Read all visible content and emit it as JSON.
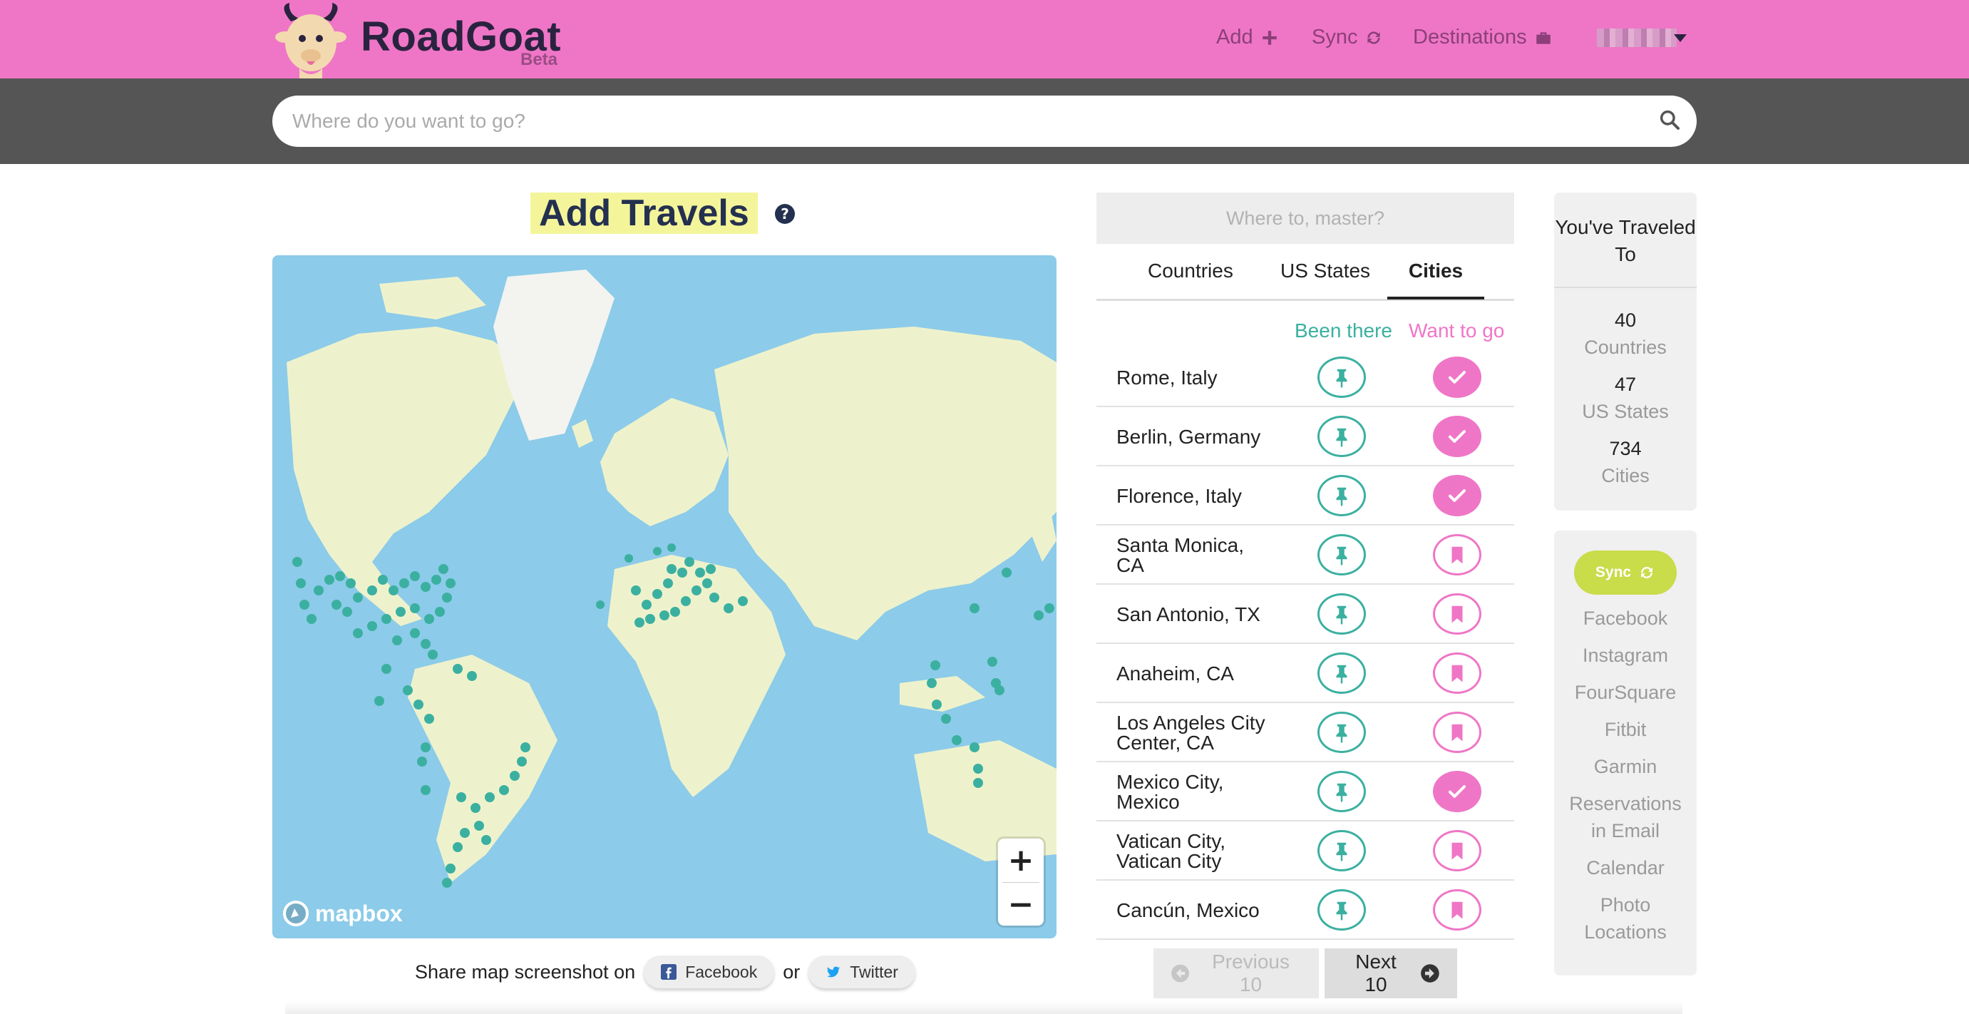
{
  "app": {
    "brand": "RoadGoat",
    "badge": "Beta"
  },
  "nav": [
    {
      "label": "Add",
      "icon": "plus-icon"
    },
    {
      "label": "Sync",
      "icon": "sync-icon"
    },
    {
      "label": "Destinations",
      "icon": "briefcase-icon"
    }
  ],
  "search": {
    "placeholder": "Where do you want to go?"
  },
  "page": {
    "title": "Add Travels"
  },
  "map": {
    "attribution": "mapbox",
    "zoom_in": "+",
    "zoom_out": "−"
  },
  "share": {
    "prefix": "Share map screenshot on",
    "or": "or",
    "facebook": "Facebook",
    "twitter": "Twitter"
  },
  "panel": {
    "search_placeholder": "Where to, master?",
    "tabs": [
      {
        "label": "Countries"
      },
      {
        "label": "US States"
      },
      {
        "label": "Cities",
        "active": true
      }
    ],
    "col_been": "Been there",
    "col_want": "Want to go",
    "rows": [
      {
        "name": "Rome, Italy",
        "want": true
      },
      {
        "name": "Berlin, Germany",
        "want": true
      },
      {
        "name": "Florence, Italy",
        "want": true
      },
      {
        "name": "Santa Monica, CA",
        "want": false
      },
      {
        "name": "San Antonio, TX",
        "want": false
      },
      {
        "name": "Anaheim, CA",
        "want": false
      },
      {
        "name": "Los Angeles City Center, CA",
        "want": false
      },
      {
        "name": "Mexico City, Mexico",
        "want": true
      },
      {
        "name": "Vatican City, Vatican City",
        "want": false
      },
      {
        "name": "Cancún, Mexico",
        "want": false
      }
    ],
    "prev": "Previous 10",
    "next": "Next 10"
  },
  "stats": {
    "heading": "You've Traveled To",
    "items": [
      {
        "count": "40",
        "label": "Countries"
      },
      {
        "count": "47",
        "label": "US States"
      },
      {
        "count": "734",
        "label": "Cities"
      }
    ]
  },
  "sync": {
    "button": "Sync",
    "sources": [
      "Facebook",
      "Instagram",
      "FourSquare",
      "Fitbit",
      "Garmin",
      "Reservations in Email",
      "Calendar",
      "Photo Locations"
    ]
  },
  "colors": {
    "brand": "#ef76c6",
    "teal": "#3bb0a0",
    "sync": "#c9dc4a",
    "title_highlight": "#f4f59a"
  }
}
